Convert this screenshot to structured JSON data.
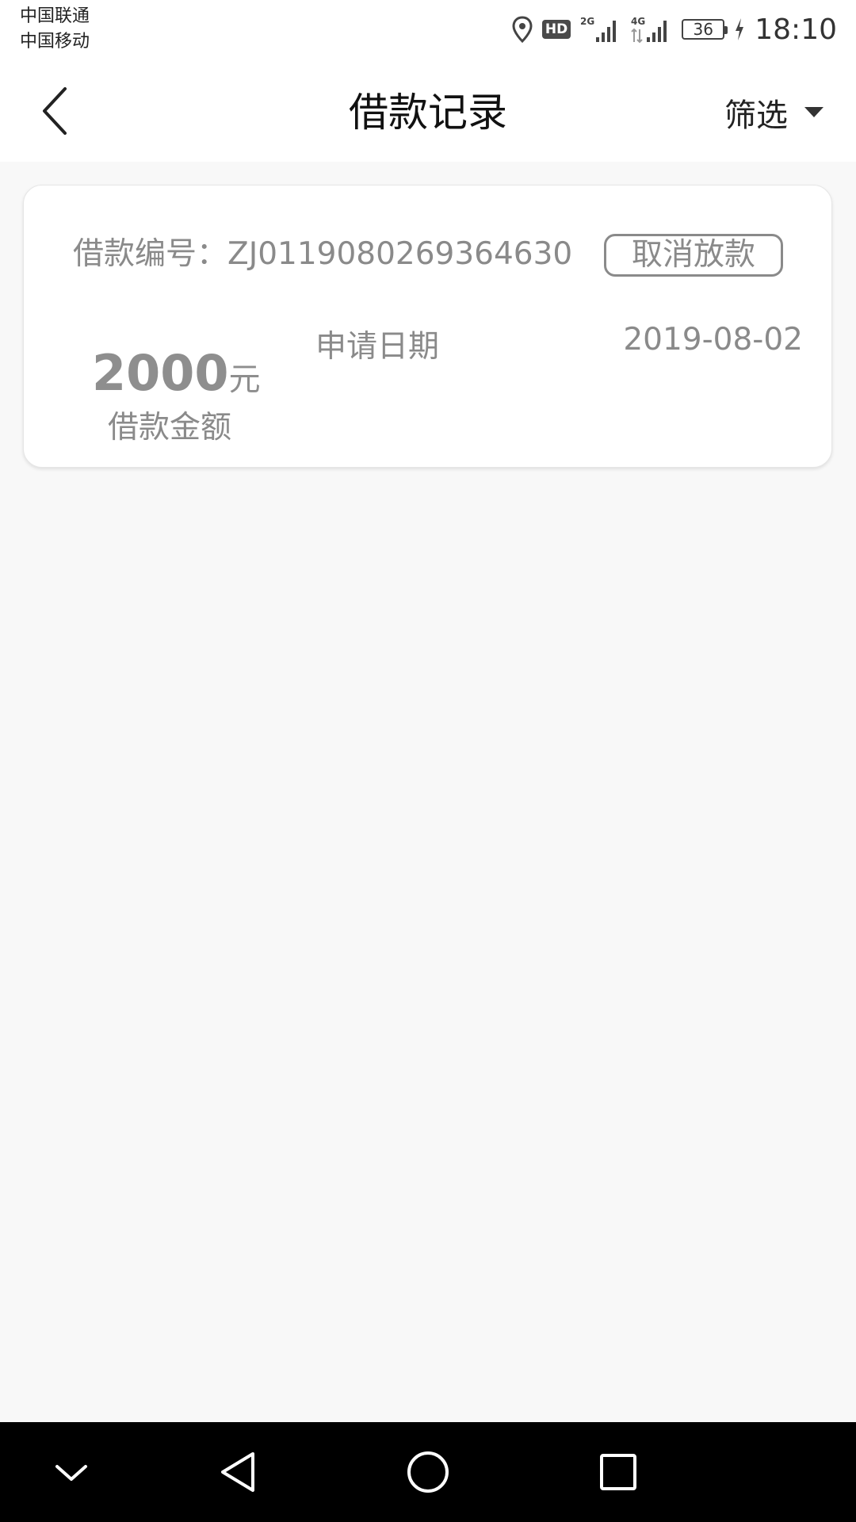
{
  "status_bar": {
    "carrier_1": "中国联通",
    "carrier_2": "中国移动",
    "hd_badge": "HD",
    "net_1": "2G",
    "net_2": "4G",
    "battery": "36",
    "time": "18:10",
    "icons": [
      "location-icon",
      "hd-icon",
      "signal-2g-icon",
      "signal-4g-icon",
      "battery-icon",
      "charging-icon"
    ]
  },
  "header": {
    "title": "借款记录",
    "filter_label": "筛选",
    "back_icon": "chevron-left-icon",
    "filter_icon": "caret-down-icon"
  },
  "records": [
    {
      "loan_no_label": "借款编号：",
      "loan_no": "ZJ0119080269364630",
      "action_label": "取消放款",
      "amount": "2000",
      "amount_unit": "元",
      "amount_label": "借款金额",
      "date_label": "申请日期",
      "date_value": "2019-08-02"
    }
  ],
  "system_nav": {
    "icons": [
      "collapse-chevron-icon",
      "back-triangle-icon",
      "home-circle-icon",
      "recents-square-icon"
    ]
  },
  "colors": {
    "header_bg": "#ffffff",
    "page_bg": "#f8f8f8",
    "muted_text": "#8a8a8a",
    "nav_bar_bg": "#000000"
  }
}
